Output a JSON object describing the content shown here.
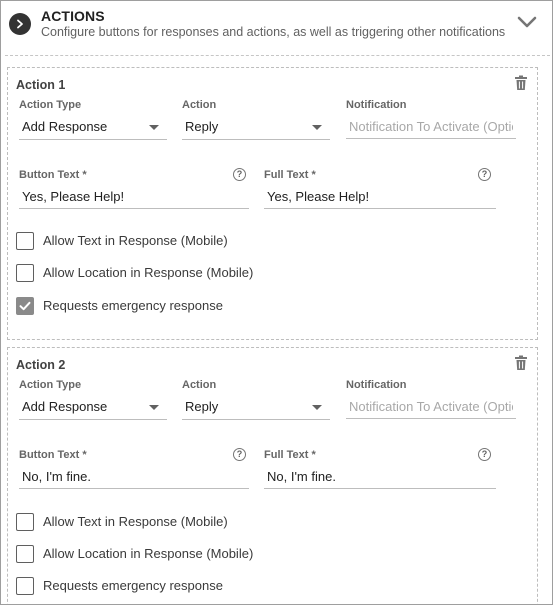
{
  "header": {
    "title": "ACTIONS",
    "subtitle": "Configure buttons for responses and actions, as well as triggering other notifications"
  },
  "actions": [
    {
      "title": "Action 1",
      "action_type_label": "Action Type",
      "action_type_value": "Add Response",
      "action_label": "Action",
      "action_value": "Reply",
      "notification_label": "Notification",
      "notification_placeholder": "Notification To Activate (Optional)",
      "button_text_label": "Button Text *",
      "button_text_value": "Yes, Please Help!",
      "full_text_label": "Full Text *",
      "full_text_value": "Yes, Please Help!",
      "help_glyph": "?",
      "checkboxes": [
        {
          "label": "Allow Text in Response (Mobile)",
          "checked": false
        },
        {
          "label": "Allow Location in Response (Mobile)",
          "checked": false
        },
        {
          "label": "Requests emergency response",
          "checked": true
        }
      ]
    },
    {
      "title": "Action 2",
      "action_type_label": "Action Type",
      "action_type_value": "Add Response",
      "action_label": "Action",
      "action_value": "Reply",
      "notification_label": "Notification",
      "notification_placeholder": "Notification To Activate (Optional)",
      "button_text_label": "Button Text *",
      "button_text_value": "No, I'm fine.",
      "full_text_label": "Full Text *",
      "full_text_value": "No, I'm fine.",
      "help_glyph": "?",
      "checkboxes": [
        {
          "label": "Allow Text in Response (Mobile)",
          "checked": false
        },
        {
          "label": "Allow Location in Response (Mobile)",
          "checked": false
        },
        {
          "label": "Requests emergency response",
          "checked": false
        }
      ]
    }
  ],
  "icons": {
    "header_toggle": "chevron-right-icon",
    "collapse": "chevron-down-icon",
    "delete": "trash-icon",
    "help": "help-circle-icon"
  },
  "colors": {
    "checkbox_checked": "#8a8a8a",
    "text_primary": "#212121",
    "label_muted": "#666666"
  }
}
